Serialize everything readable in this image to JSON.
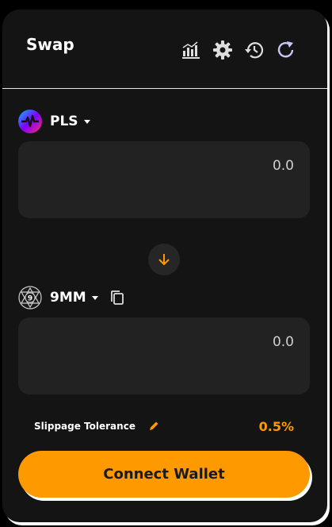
{
  "header": {
    "title": "Swap",
    "icons": [
      "chart-icon",
      "gear-icon",
      "history-icon",
      "refresh-icon"
    ]
  },
  "from_token": {
    "symbol": "PLS",
    "amount": "0.0",
    "logo_icon": "pulse-logo-icon"
  },
  "to_token": {
    "symbol": "9MM",
    "amount": "0.0",
    "logo_icon": "9mm-logo-icon"
  },
  "swap_direction_icon": "arrow-down-icon",
  "slippage": {
    "label": "Slippage Tolerance",
    "value": "0.5%"
  },
  "connect_button": {
    "label": "Connect Wallet"
  },
  "colors": {
    "accent": "#ff9900",
    "card_bg": "#141414",
    "input_bg": "#222222"
  }
}
